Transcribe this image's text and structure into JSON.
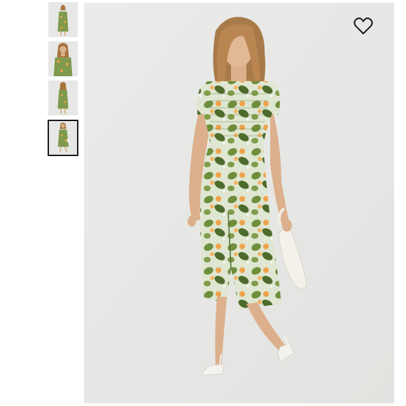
{
  "product": {
    "name": "",
    "thumbnails": [
      {
        "view": "front-full",
        "selected": false
      },
      {
        "view": "front-closeup",
        "selected": false
      },
      {
        "view": "back-full",
        "selected": false
      },
      {
        "view": "side-walking",
        "selected": true
      }
    ],
    "main_image_view": "side-walking",
    "dress_pattern_colors": {
      "base": "#dfe6d2",
      "leaf": "#6f8e3c",
      "leaf_dark": "#4d6b2a",
      "fruit": "#f0a24a"
    }
  },
  "icons": {
    "wishlist": "heart-outline-icon"
  },
  "colors": {
    "background": "#ffffff",
    "photo_background": "#e6e7e5",
    "selected_border": "#1a1a1a"
  }
}
